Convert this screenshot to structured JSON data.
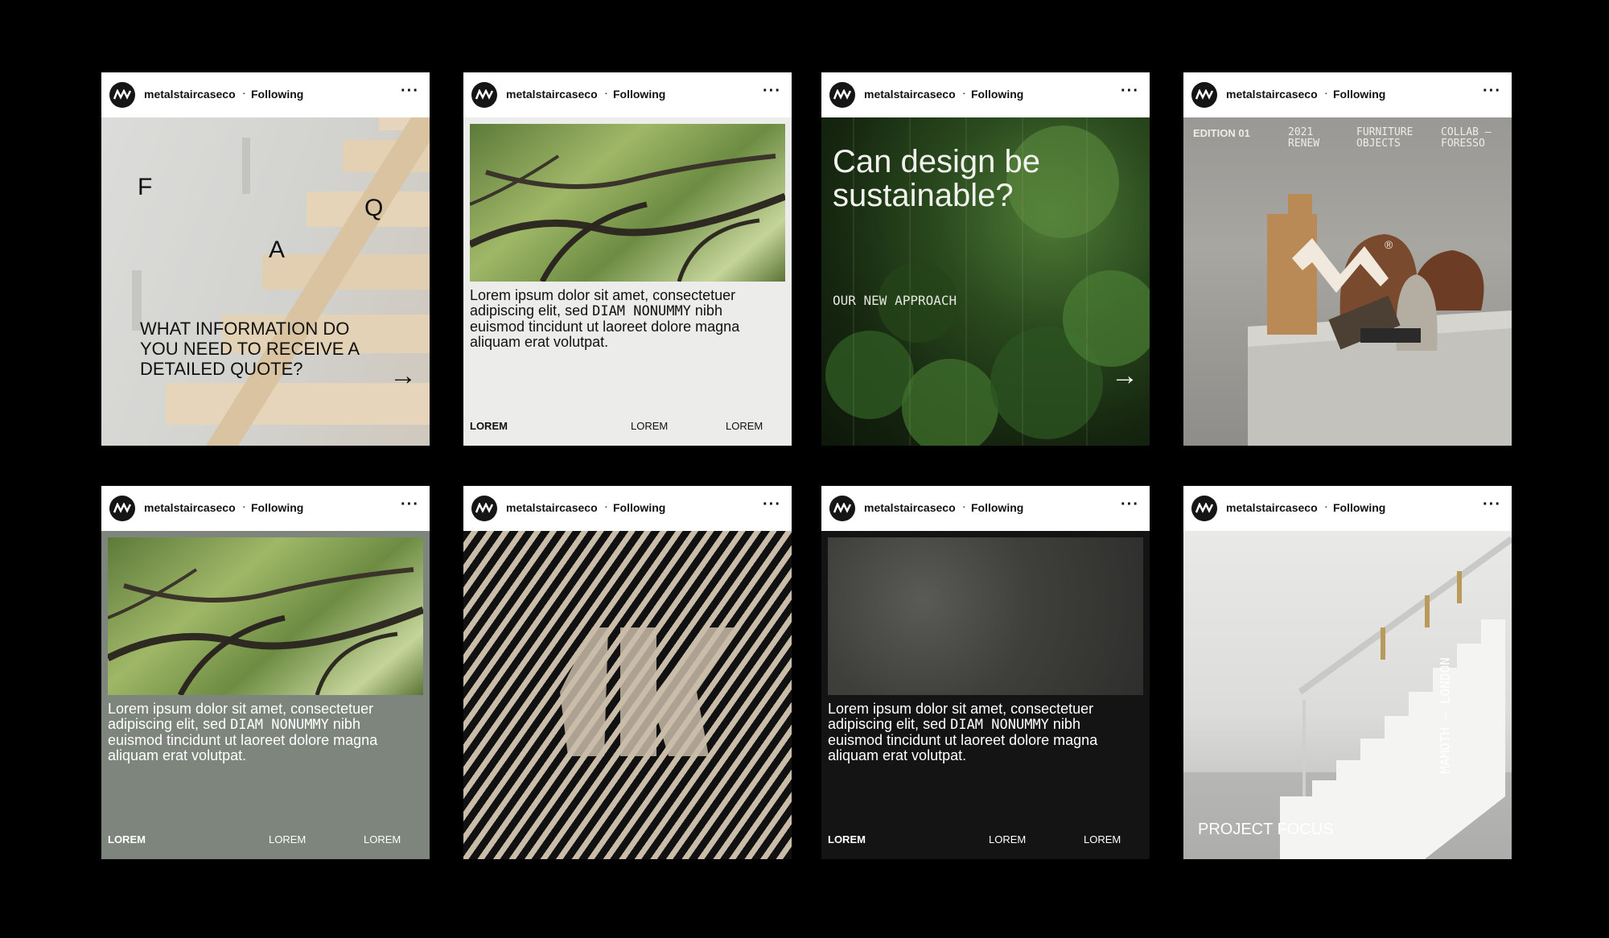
{
  "posts": [
    {
      "username": "metalstaircaseco",
      "separator": "·",
      "status": "Following",
      "more": "···",
      "letters": [
        "F",
        "Q",
        "A"
      ],
      "heading": "WHAT INFORMATION DO YOU NEED TO RECEIVE A DETAILED QUOTE?",
      "arrow": "→"
    },
    {
      "username": "metalstaircaseco",
      "separator": "·",
      "status": "Following",
      "more": "···",
      "text_a": "Lorem ipsum dolor sit amet, consectetuer adipiscing elit, sed ",
      "text_mono": "DIAM NONUMMY",
      "text_b": " nibh euismod tincidunt ut laoreet dolore magna aliquam erat volutpat.",
      "footer": [
        "LOREM",
        "LOREM",
        "LOREM"
      ]
    },
    {
      "username": "metalstaircaseco",
      "separator": "·",
      "status": "Following",
      "more": "···",
      "headline": "Can design be sustainable?",
      "subline": "OUR NEW APPROACH",
      "arrow": "→"
    },
    {
      "username": "metalstaircaseco",
      "separator": "·",
      "status": "Following",
      "more": "···",
      "tags": [
        "EDITION 01",
        "2021 RENEW",
        "FURNITURE OBJECTS",
        "COLLAB — FORESSO"
      ],
      "registered": "®"
    },
    {
      "username": "metalstaircaseco",
      "separator": "·",
      "status": "Following",
      "more": "···",
      "text_a": "Lorem ipsum dolor sit amet, consectetuer adipiscing elit, sed ",
      "text_mono": "DIAM NONUMMY",
      "text_b": " nibh euismod tincidunt ut laoreet dolore magna aliquam erat volutpat.",
      "footer": [
        "LOREM",
        "LOREM",
        "LOREM"
      ]
    },
    {
      "username": "metalstaircaseco",
      "separator": "·",
      "status": "Following",
      "more": "···"
    },
    {
      "username": "metalstaircaseco",
      "separator": "·",
      "status": "Following",
      "more": "···",
      "text_a": "Lorem ipsum dolor sit amet, consectetuer adipiscing elit, sed ",
      "text_mono": "DIAM NONUMMY",
      "text_b": " nibh euismod tincidunt ut laoreet dolore magna aliquam erat volutpat.",
      "footer": [
        "LOREM",
        "LOREM",
        "LOREM"
      ]
    },
    {
      "username": "metalstaircaseco",
      "separator": "·",
      "status": "Following",
      "more": "···",
      "label": "PROJECT FOCUS",
      "vertical": "MAMOTH — LONDON"
    }
  ],
  "colors": {
    "page_bg": "#000000",
    "card_light": "#ececea",
    "card_sage": "#7d857c",
    "card_dark": "#141414",
    "stripe_beige": "#c9bca9"
  },
  "icons": {
    "avatar": "wave-logo-icon",
    "more": "more-options-icon",
    "arrow": "arrow-right-icon"
  }
}
